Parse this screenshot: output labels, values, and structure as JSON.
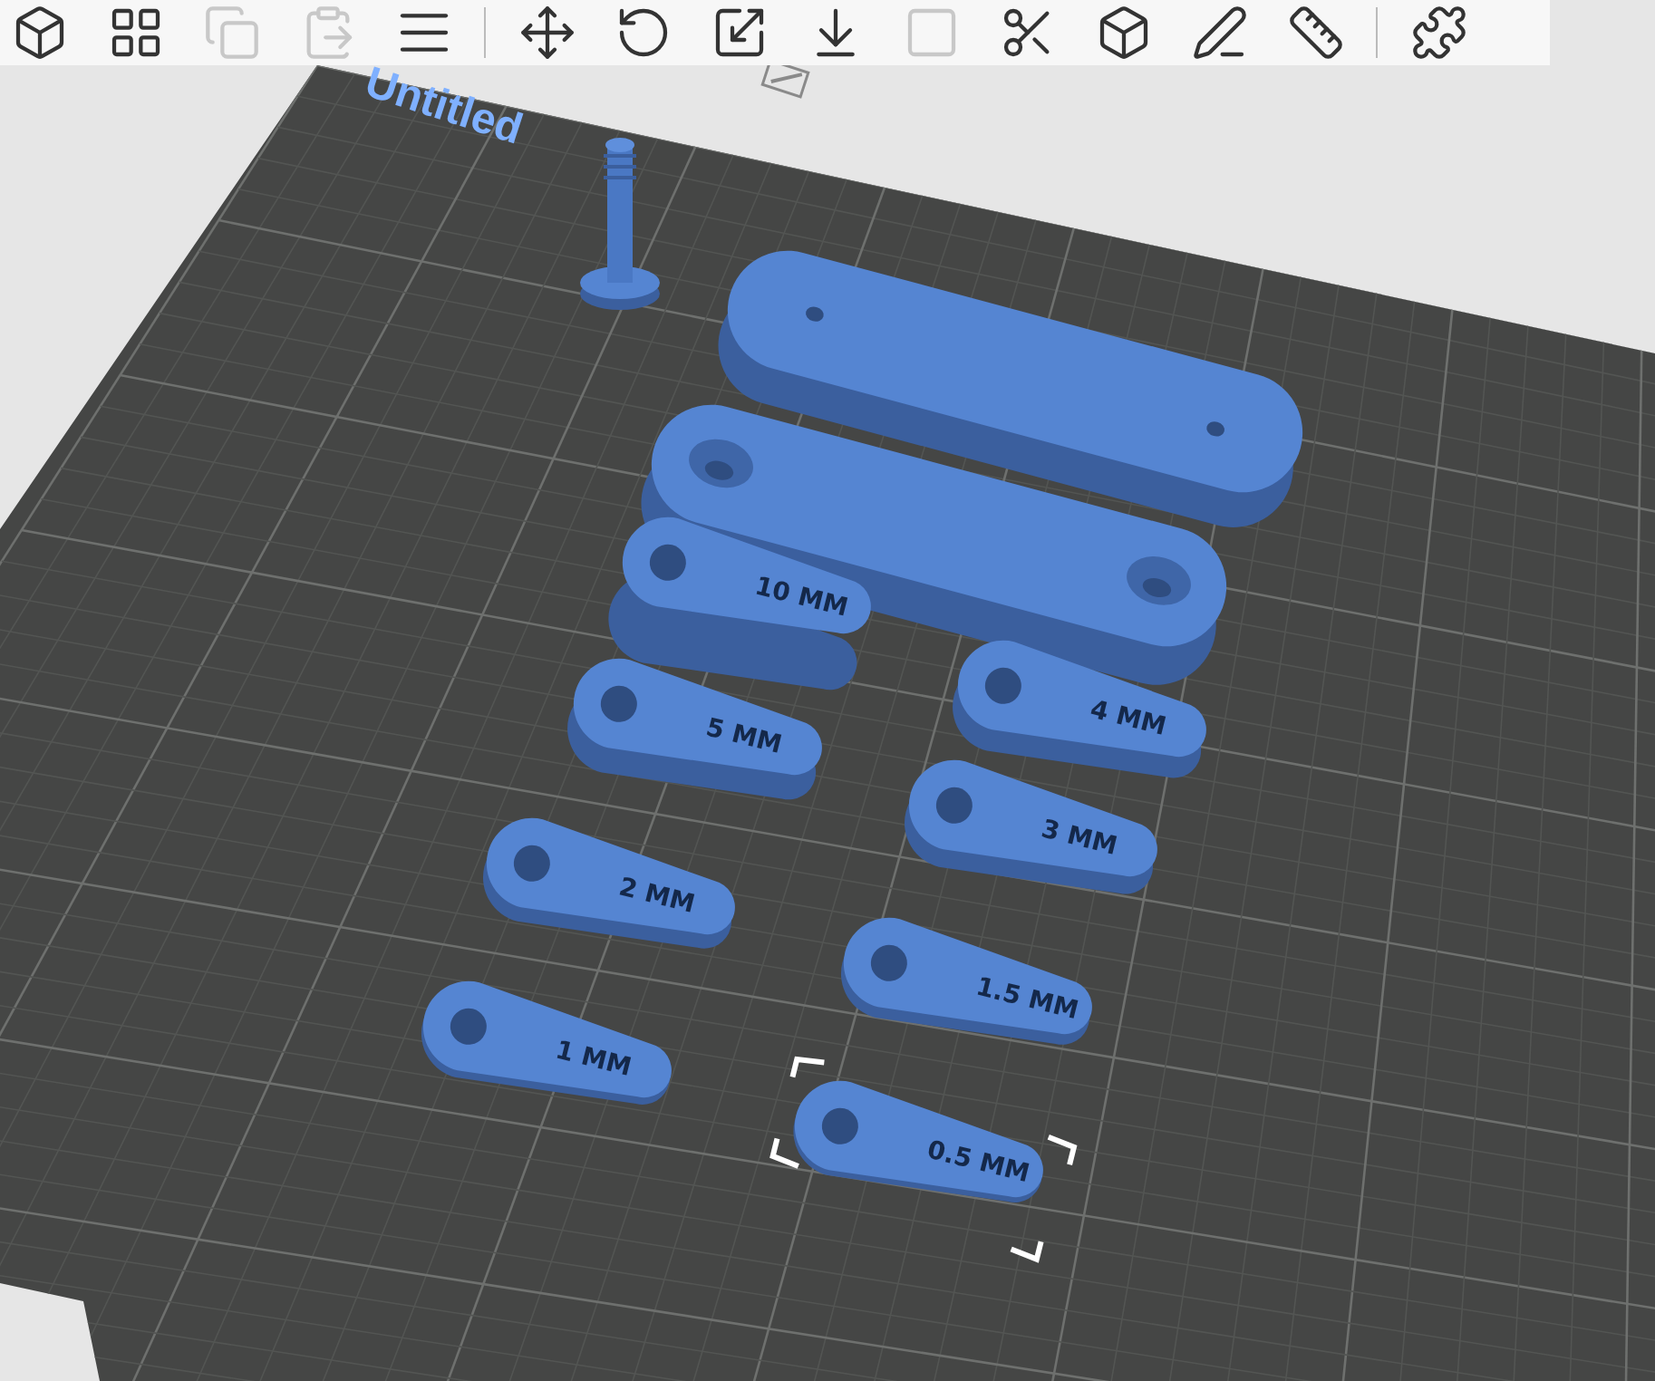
{
  "toolbar": {
    "groups": [
      [
        {
          "disabled": false
        },
        {
          "disabled": false
        },
        {
          "disabled": true
        },
        {
          "disabled": true
        },
        {
          "disabled": false
        }
      ],
      [
        {
          "disabled": false
        },
        {
          "disabled": false
        },
        {
          "disabled": false
        },
        {
          "disabled": false
        },
        {
          "disabled": true
        },
        {
          "disabled": false
        },
        {
          "disabled": false
        },
        {
          "disabled": false
        },
        {
          "disabled": false
        }
      ],
      [
        {
          "disabled": false
        }
      ]
    ]
  },
  "project": {
    "name": "Untitled"
  },
  "parts": [
    {
      "kind": "pin",
      "selected": false
    },
    {
      "kind": "bar",
      "selected": false
    },
    {
      "kind": "bar",
      "selected": false
    },
    {
      "kind": "tab",
      "label": "10 MM",
      "selected": false
    },
    {
      "kind": "tab",
      "label": "5 MM",
      "selected": false
    },
    {
      "kind": "tab",
      "label": "4 MM",
      "selected": false
    },
    {
      "kind": "tab",
      "label": "3 MM",
      "selected": false
    },
    {
      "kind": "tab",
      "label": "2 MM",
      "selected": false
    },
    {
      "kind": "tab",
      "label": "1.5 MM",
      "selected": false
    },
    {
      "kind": "tab",
      "label": "1 MM",
      "selected": false
    },
    {
      "kind": "tab",
      "label": "0.5 MM",
      "selected": true
    }
  ]
}
